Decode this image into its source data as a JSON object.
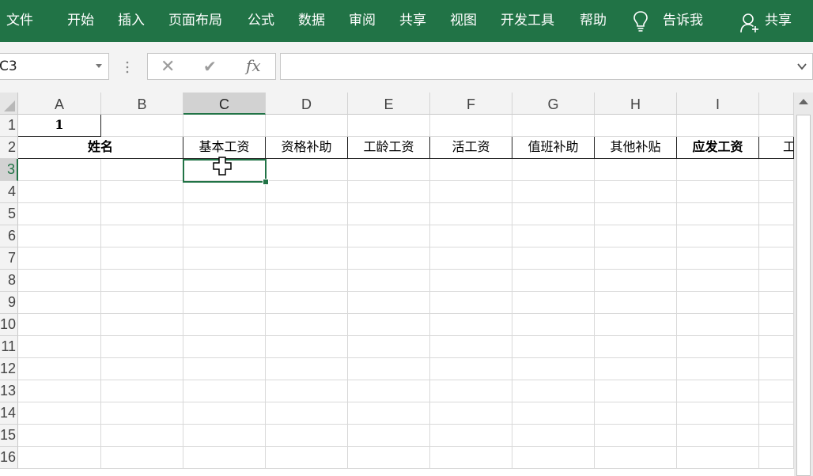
{
  "ribbon": {
    "tabs": [
      "文件",
      "开始",
      "插入",
      "页面布局",
      "公式",
      "数据",
      "审阅",
      "共享",
      "视图",
      "开发工具",
      "帮助"
    ],
    "tell_me": "告诉我",
    "share": "共享",
    "bg_color": "#217346"
  },
  "formula_bar": {
    "name_box": "C3",
    "cancel_symbol": "✕",
    "enter_symbol": "✔",
    "fx_label": "fx",
    "formula_value": ""
  },
  "sheet": {
    "columns": [
      "A",
      "B",
      "C",
      "D",
      "E",
      "F",
      "G",
      "H",
      "I"
    ],
    "rows": [
      "1",
      "2",
      "3",
      "4",
      "5",
      "6",
      "7",
      "8",
      "9",
      "10",
      "11",
      "12",
      "13",
      "14",
      "15",
      "16"
    ],
    "active_cell": "C3",
    "cells": {
      "A1": "1",
      "A2": "姓名",
      "C2": "基本工资",
      "D2": "资格补助",
      "E2": "工龄工资",
      "F2": "活工资",
      "G2": "值班补助",
      "H2": "其他补贴",
      "I2": "应发工资",
      "J2": "工"
    }
  }
}
